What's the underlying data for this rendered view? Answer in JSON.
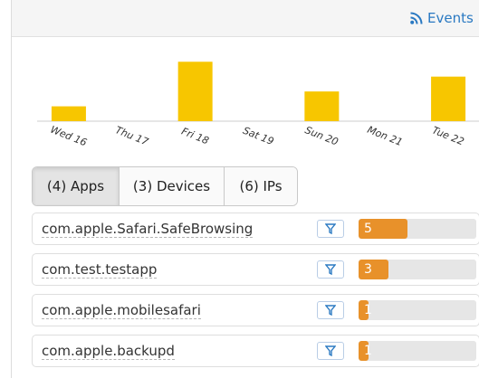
{
  "header": {
    "events_label": "Events",
    "icon": "rss-icon",
    "link_color": "#2a79c2"
  },
  "chart_data": {
    "type": "bar",
    "categories": [
      "Wed 16",
      "Thu 17",
      "Fri 18",
      "Sat 19",
      "Sun 20",
      "Mon 21",
      "Tue 22"
    ],
    "values": [
      1,
      0,
      4,
      0,
      2,
      0,
      3
    ],
    "ylim": [
      0,
      4.2
    ],
    "bar_color": "#f7c600",
    "grid": false
  },
  "tabs": [
    {
      "label": "(4) Apps",
      "active": true
    },
    {
      "label": "(3) Devices",
      "active": false
    },
    {
      "label": "(6) IPs",
      "active": false
    }
  ],
  "apps": {
    "max_count": 12,
    "bar_color": "#e8912a",
    "items": [
      {
        "label": "com.apple.Safari.SafeBrowsing",
        "count": "5",
        "value": 5
      },
      {
        "label": "com.test.testapp",
        "count": "3",
        "value": 3
      },
      {
        "label": "com.apple.mobilesafari",
        "count": "1",
        "value": 1
      },
      {
        "label": "com.apple.backupd",
        "count": "1",
        "value": 1
      }
    ]
  }
}
